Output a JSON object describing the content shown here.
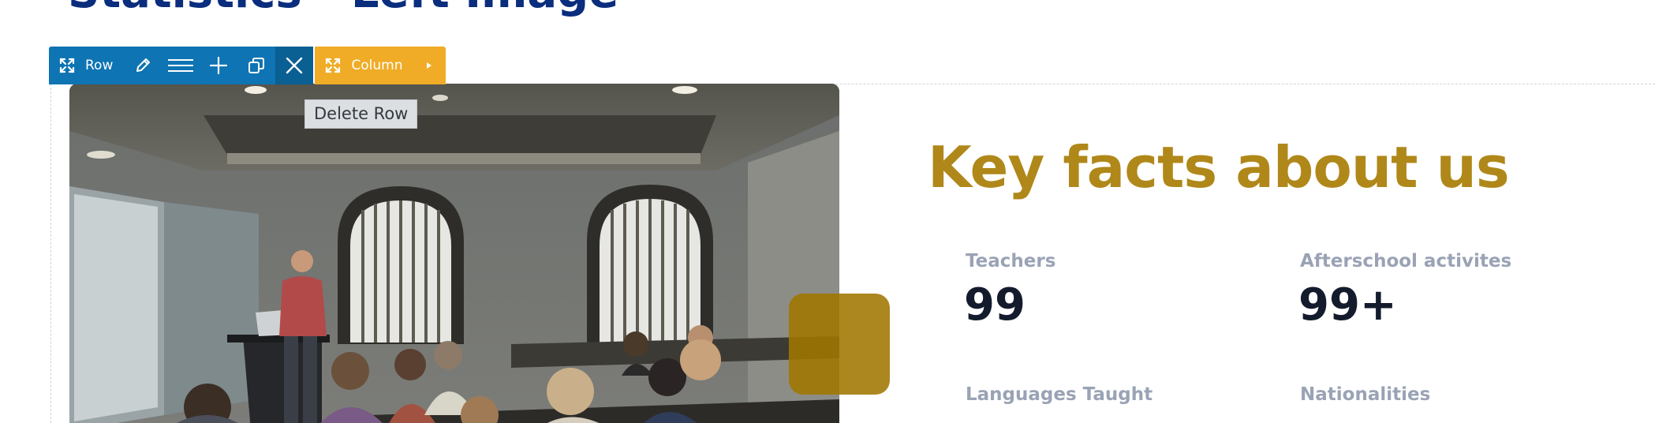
{
  "page": {
    "top_heading": "Statistics - Left Image"
  },
  "toolbar": {
    "row_label": "Row",
    "column_label": "Column",
    "row_color": "#0e74b3",
    "column_color": "#f0ac26",
    "icons": [
      "move-icon",
      "pencil-icon",
      "menu-lines-icon",
      "plus-icon",
      "duplicate-icon",
      "close-icon",
      "chevron-right-icon"
    ]
  },
  "tooltip": {
    "text": "Delete Row"
  },
  "content": {
    "heading": "Key facts about us",
    "heading_color": "#b0881a",
    "stats": [
      {
        "label": "Teachers",
        "value": "99"
      },
      {
        "label": "Afterschool activites",
        "value": "99+"
      },
      {
        "label": "Languages Taught",
        "value": ""
      },
      {
        "label": "Nationalities",
        "value": ""
      }
    ]
  }
}
